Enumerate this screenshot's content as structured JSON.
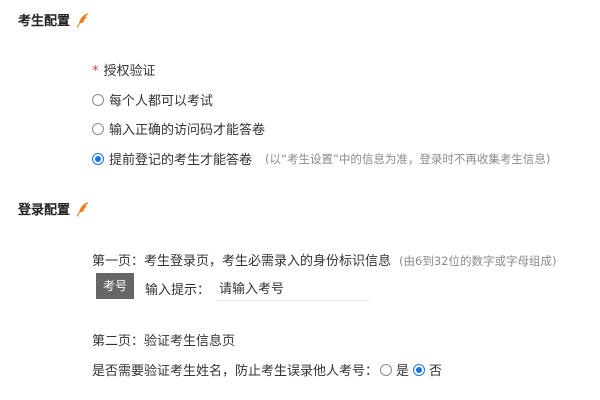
{
  "exam_config": {
    "title": "考生配置",
    "auth_label": "授权验证",
    "required_mark": "*",
    "options": [
      {
        "label": "每个人都可以考试",
        "selected": false
      },
      {
        "label": "输入正确的访问码才能答卷",
        "selected": false
      },
      {
        "label": "提前登记的考生才能答卷",
        "selected": true
      }
    ],
    "option3_hint": "(以“考生设置”中的信息为准，登录时不再收集考生信息)"
  },
  "login_config": {
    "title": "登录配置",
    "page1_text": "第一页：考生登录页，考生必需录入的身份标识信息",
    "page1_hint": "(由6到32位的数字或字母组成)",
    "tag_label": "考号",
    "input_prompt_label": "输入提示：",
    "input_prompt_value": "请输入考号",
    "page2_text": "第二页：验证考生信息页",
    "verify_question": "是否需要验证考生姓名，防止考生误录他人考号：",
    "yes_label": "是",
    "no_label": "否",
    "verify_selected": "否"
  },
  "colors": {
    "accent": "#1a73e8",
    "required": "#e23b3b",
    "icon": "#f07c1a",
    "tag_bg": "#666666"
  }
}
